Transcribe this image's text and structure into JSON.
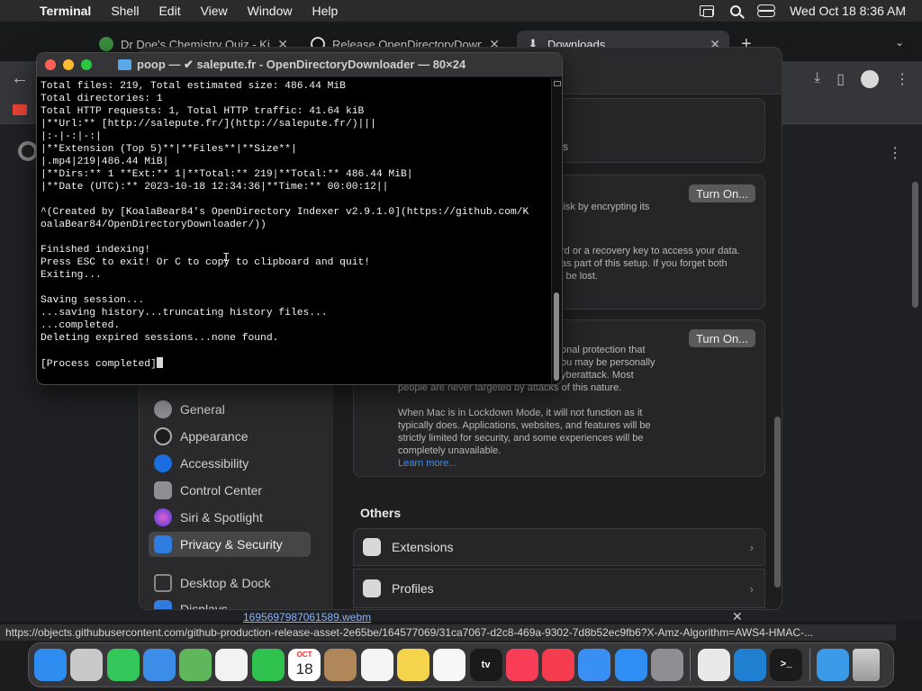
{
  "menubar": {
    "app_name": "Terminal",
    "items": [
      "Shell",
      "Edit",
      "View",
      "Window",
      "Help"
    ],
    "clock": "Wed Oct 18  8:36 AM"
  },
  "browser": {
    "tabs": [
      {
        "title": "Dr Doe's Chemistry Quiz - Kir"
      },
      {
        "title": "Release OpenDirectoryDownlo"
      },
      {
        "title": "Downloads"
      }
    ],
    "download_file": "1695697987061589.webm",
    "status_url": "https://objects.githubusercontent.com/github-production-release-asset-2e65be/164577069/31ca7067-d2c8-469a-9302-7d8b52ec9fb6?X-Amz-Algorithm=AWS4-HMAC-..."
  },
  "settings": {
    "sidebar": {
      "items": [
        {
          "label": "General",
          "color": "#8e8e93"
        },
        {
          "label": "Appearance",
          "color": "#1c1c1e"
        },
        {
          "label": "Accessibility",
          "color": "#1a6ee0"
        },
        {
          "label": "Control Center",
          "color": "#8e8e93"
        },
        {
          "label": "Siri & Spotlight",
          "color": "#b44ad9"
        },
        {
          "label": "Privacy & Security",
          "color": "#2f7de1"
        },
        {
          "label": "Desktop & Dock",
          "color": "#2c2c2e"
        },
        {
          "label": "Displays",
          "color": "#2f7de1"
        }
      ],
      "selected": "Privacy & Security"
    },
    "card1_text": "rs",
    "filevault": {
      "line1": "lisk by encrypting its",
      "line2": "rd or a recovery key to access your data.",
      "line3": "as part of this setup. If you forget both",
      "line4": "l be lost.",
      "button": "Turn On..."
    },
    "lockdown": {
      "line1": "onal protection that",
      "line2": "ou may be personally",
      "line3": "yberattack. Most",
      "line4": "people are never targeted by attacks of this nature.",
      "line5": "When Mac is in Lockdown Mode, it will not function as it",
      "line6": "typically does. Applications, websites, and features will be",
      "line7": "strictly limited for security, and some experiences will be",
      "line8": "completely unavailable.",
      "learn_more": "Learn more...",
      "button": "Turn On..."
    },
    "others_title": "Others",
    "others": [
      {
        "label": "Extensions"
      },
      {
        "label": "Profiles"
      }
    ]
  },
  "terminal": {
    "title": "poop — ✔ salepute.fr - OpenDirectoryDownloader — 80×24",
    "lines": [
      "Total files: 219, Total estimated size: 486.44 MiB",
      "Total directories: 1",
      "Total HTTP requests: 1, Total HTTP traffic: 41.64 kiB",
      "|**Url:** [http://salepute.fr/](http://salepute.fr/)|||",
      "|:-|-:|-:|",
      "|**Extension (Top 5)**|**Files**|**Size**|",
      "|.mp4|219|486.44 MiB|",
      "|**Dirs:** 1 **Ext:** 1|**Total:** 219|**Total:** 486.44 MiB|",
      "|**Date (UTC):** 2023-10-18 12:34:36|**Time:** 00:00:12||",
      "",
      "^(Created by [KoalaBear84's OpenDirectory Indexer v2.9.1.0](https://github.com/K",
      "oalaBear84/OpenDirectoryDownloader/))",
      "",
      "Finished indexing!",
      "Press ESC to exit! Or C to copy to clipboard and quit!",
      "Exiting...",
      "",
      "Saving session...",
      "...saving history...truncating history files...",
      "...completed.",
      "Deleting expired sessions...none found.",
      "",
      "[Process completed]"
    ]
  },
  "dock": {
    "apps": [
      {
        "name": "Finder",
        "color": "#2f8cf0"
      },
      {
        "name": "Launchpad",
        "color": "#c9c9c9"
      },
      {
        "name": "Messages",
        "color": "#34c759"
      },
      {
        "name": "Mail",
        "color": "#3b8de8"
      },
      {
        "name": "Maps",
        "color": "#5fb65b"
      },
      {
        "name": "Photos",
        "color": "#f2f2f2"
      },
      {
        "name": "FaceTime",
        "color": "#30c24e"
      },
      {
        "name": "Calendar",
        "color": "#ffffff"
      },
      {
        "name": "Contacts",
        "color": "#b08758"
      },
      {
        "name": "Reminders",
        "color": "#f5f5f5"
      },
      {
        "name": "Notes",
        "color": "#f4d44d"
      },
      {
        "name": "Freeform",
        "color": "#f7f7f7"
      },
      {
        "name": "TV",
        "color": "#1a1a1a"
      },
      {
        "name": "Music",
        "color": "#fa3d56"
      },
      {
        "name": "News",
        "color": "#f53d4f"
      },
      {
        "name": "Keynote",
        "color": "#3a8ff5"
      },
      {
        "name": "App Store",
        "color": "#2f8ef4"
      },
      {
        "name": "System Settings",
        "color": "#8e8e93"
      },
      {
        "name": "Chrome",
        "color": "#e9e9e9"
      },
      {
        "name": "VS Code",
        "color": "#1f7fd1"
      },
      {
        "name": "Terminal",
        "color": "#1b1b1b"
      }
    ],
    "calendar_month": "OCT",
    "calendar_day": "18",
    "tv_label": "tv",
    "terminal_label": ">_"
  }
}
